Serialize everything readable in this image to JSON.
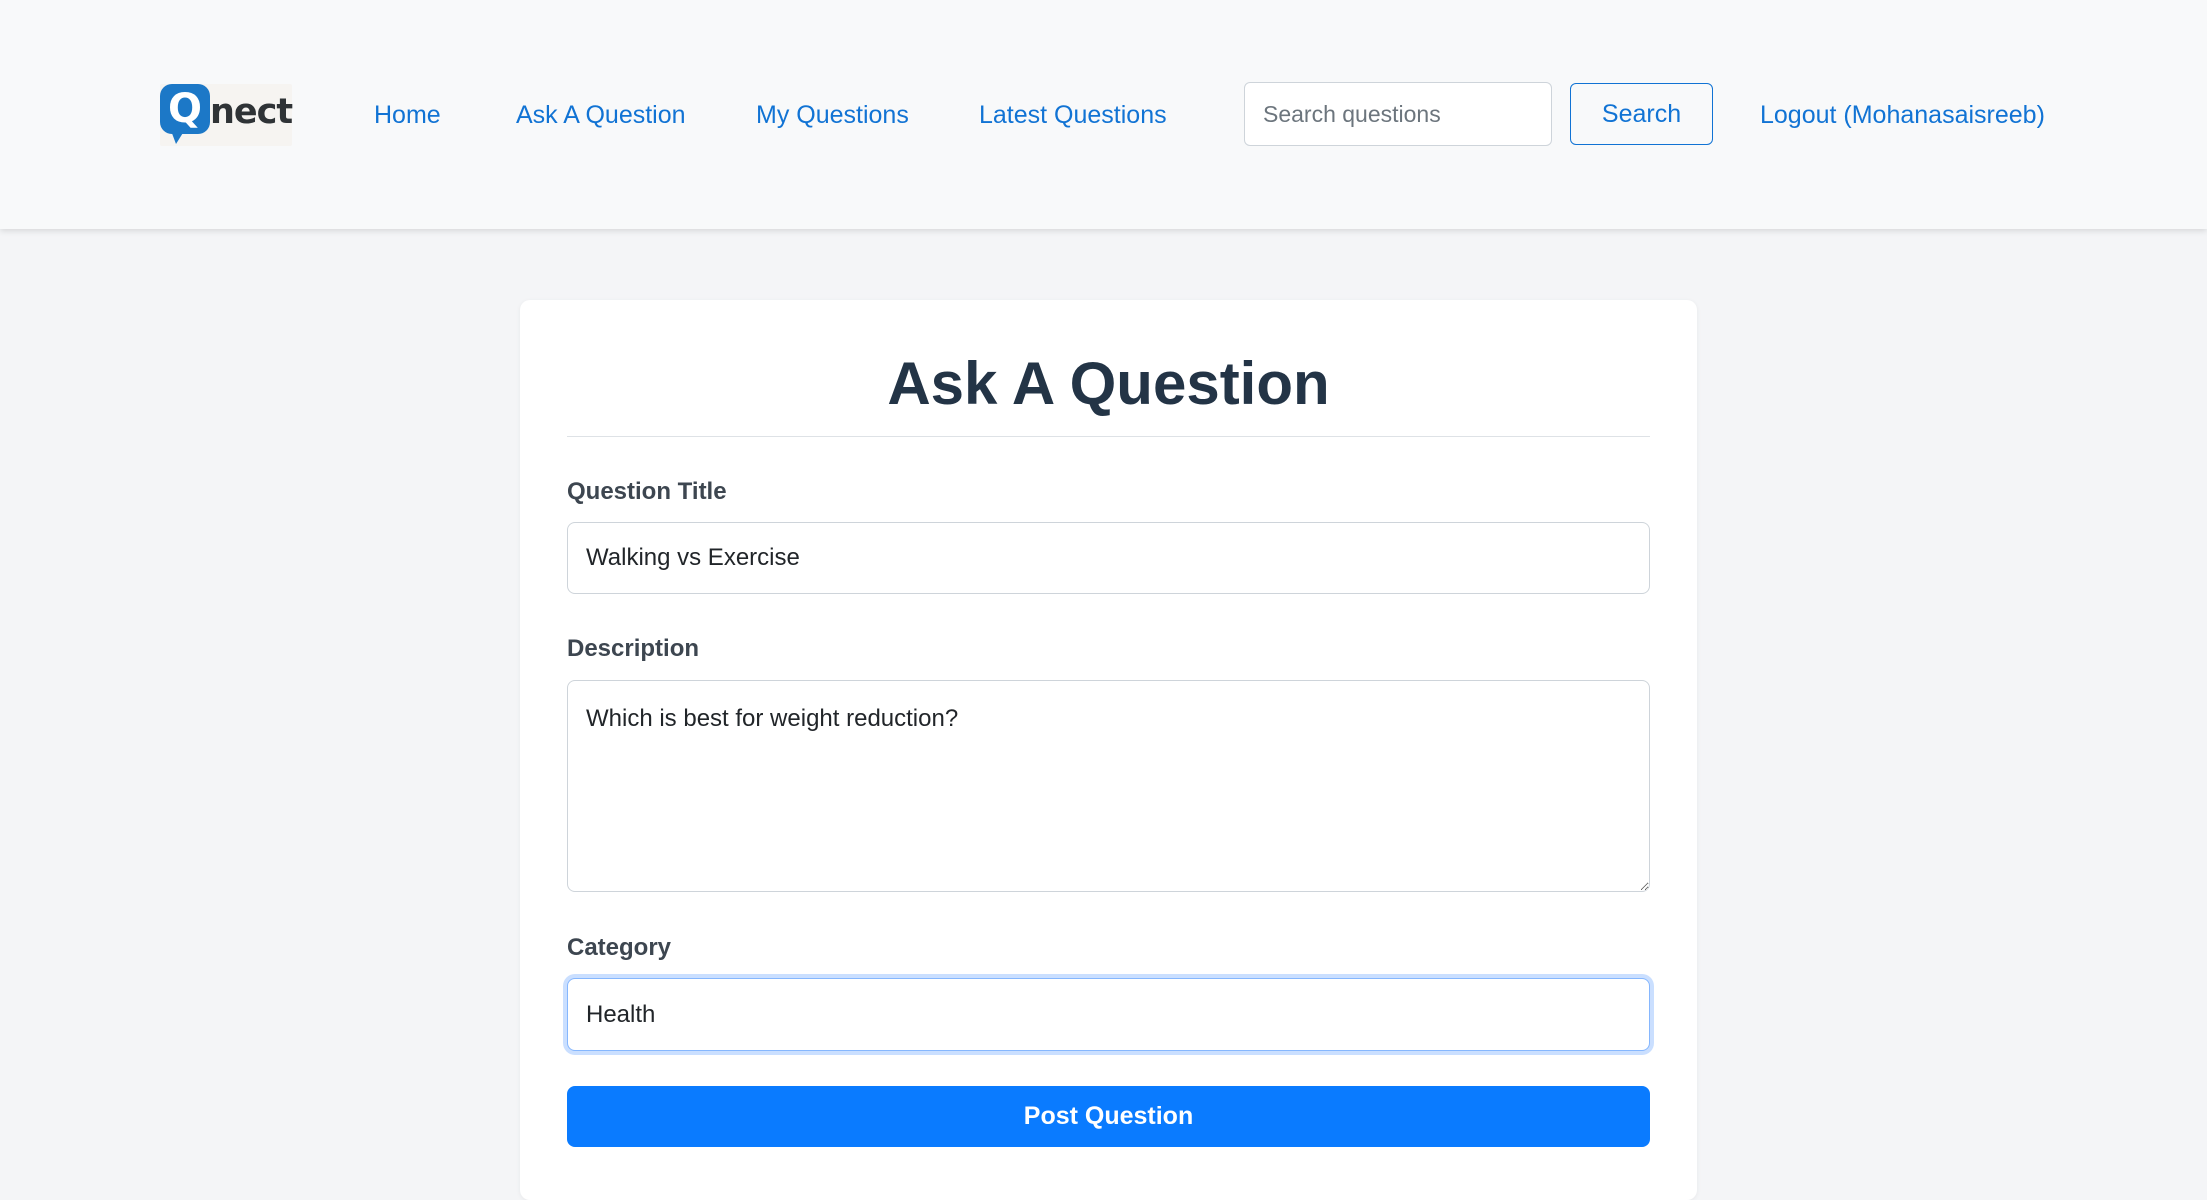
{
  "brand": {
    "logo_letter": "Q",
    "logo_word": "nect",
    "color": "#1c78c7"
  },
  "nav": {
    "home": "Home",
    "ask": "Ask A Question",
    "my_questions": "My Questions",
    "latest": "Latest Questions",
    "logout": "Logout (Mohanasaisreeb)"
  },
  "search": {
    "placeholder": "Search questions",
    "button_label": "Search"
  },
  "form": {
    "heading": "Ask A Question",
    "title_label": "Question Title",
    "title_value": "Walking vs Exercise",
    "description_label": "Description",
    "description_value": "Which is best for weight reduction?",
    "category_label": "Category",
    "category_value": "Health",
    "submit_label": "Post Question"
  },
  "colors": {
    "accent": "#1173d4",
    "primary_button": "#0a7bff",
    "heading": "#233446"
  }
}
